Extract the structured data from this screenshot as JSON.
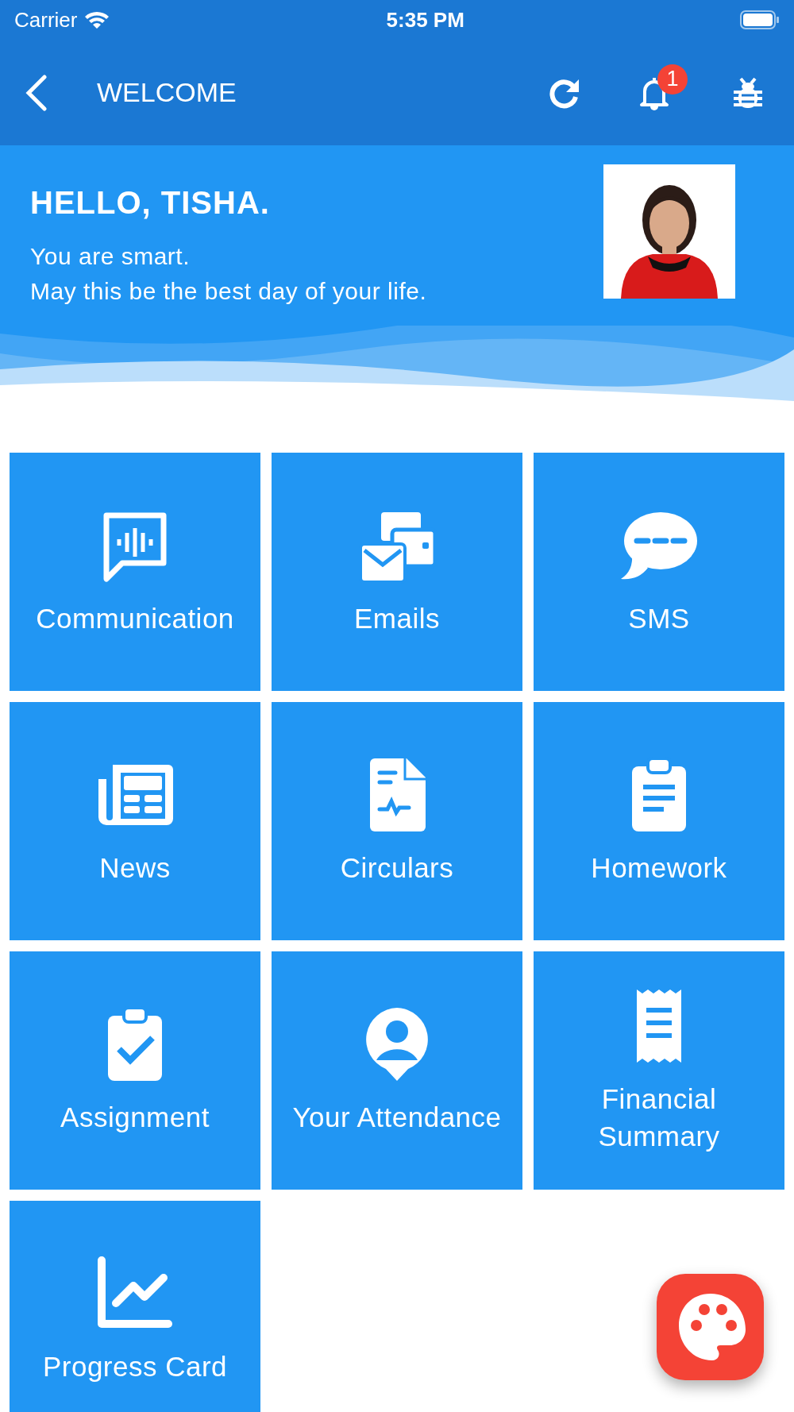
{
  "status_bar": {
    "carrier": "Carrier",
    "time": "5:35 PM"
  },
  "app_bar": {
    "title": "WELCOME",
    "notification_count": "1"
  },
  "greeting": {
    "title": "HELLO, TISHA.",
    "lines": [
      "You are smart.",
      "May this be the best day of your life."
    ]
  },
  "tiles": [
    {
      "label": "Communication"
    },
    {
      "label": "Emails"
    },
    {
      "label": "SMS"
    },
    {
      "label": "News"
    },
    {
      "label": "Circulars"
    },
    {
      "label": "Homework"
    },
    {
      "label": "Assignment"
    },
    {
      "label": "Your Attendance"
    },
    {
      "label": "Financial Summary"
    },
    {
      "label": "Progress Card"
    }
  ]
}
